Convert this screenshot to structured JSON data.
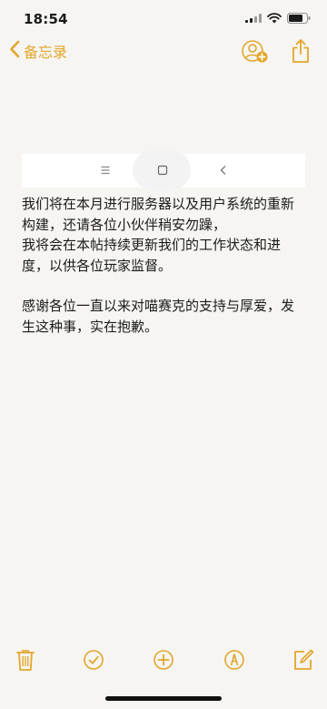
{
  "status_bar": {
    "time": "18:54"
  },
  "nav": {
    "back_label": "备忘录",
    "icons": {
      "back": "chevron-left-icon",
      "share_people": "person-add-icon",
      "share": "share-icon"
    }
  },
  "navigation_bar_screenshot": {
    "icons": [
      "menu-icon",
      "home-square-icon",
      "back-arrow-icon"
    ]
  },
  "note": {
    "paragraphs": [
      [
        "我们将在本月进行服务器以及用户系统的重新",
        "构建，还请各位小伙伴稍安勿躁，",
        "我将会在本帖持续更新我们的工作状态和进",
        "度，以供各位玩家监督。"
      ],
      [
        "感谢各位一直以来对喵赛克的支持与厚爱，发",
        "生这种事，实在抱歉。"
      ]
    ]
  },
  "toolbar": {
    "icons": [
      "trash-icon",
      "checklist-icon",
      "add-icon",
      "markup-icon",
      "compose-icon"
    ]
  },
  "colors": {
    "accent": "#e2a62b",
    "background": "#f6f5f2",
    "text": "#1b1b1b"
  }
}
